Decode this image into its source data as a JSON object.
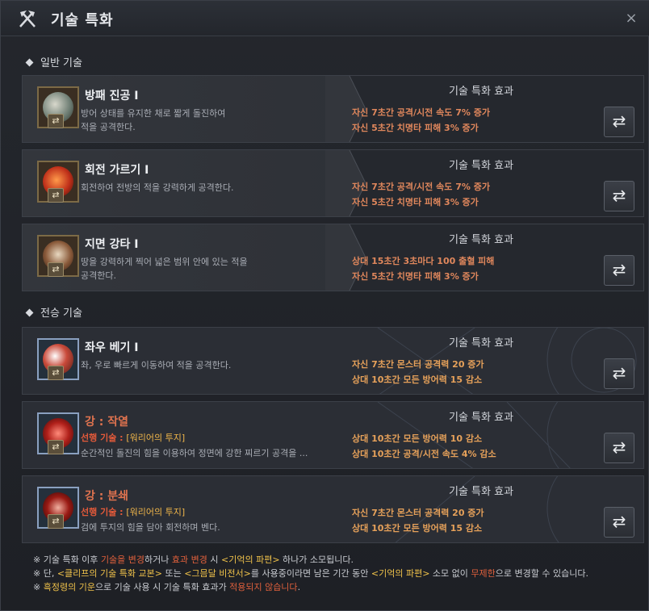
{
  "window": {
    "title": "기술 특화",
    "close_label": "×"
  },
  "sections": {
    "general": "일반 기술",
    "inherited": "전승 기술"
  },
  "effect_header": "기술 특화 효과",
  "swap_icon": "swap-arrows-icon",
  "swap_glyph": "⇄",
  "badge_glyph": "⇄",
  "general_skills": [
    {
      "name": "방패 진공 I",
      "desc1": "방어 상태를 유지한 채로 짧게 돌진하여",
      "desc2": "적을 공격한다.",
      "effects": [
        "자신 7초간 공격/시전 속도 7% 증가",
        "자신 5초간 치명타 피해 3% 증가"
      ]
    },
    {
      "name": "회전 가르기 I",
      "desc1": "회전하여 전방의 적을 강력하게 공격한다.",
      "desc2": "",
      "effects": [
        "자신 7초간 공격/시전 속도 7% 증가",
        "자신 5초간 치명타 피해 3% 증가"
      ]
    },
    {
      "name": "지면 강타 I",
      "desc1": "땅을 강력하게 찍어 넓은 범위 안에 있는 적을",
      "desc2": "공격한다.",
      "effects": [
        "상대 15초간 3초마다 100 출혈 피해",
        "자신 5초간 치명타 피해 3% 증가"
      ]
    }
  ],
  "inherited_skills": [
    {
      "name": "좌우 베기 I",
      "desc1": "좌, 우로 빠르게 이동하여 적을 공격한다.",
      "effects": [
        "자신 7초간 몬스터 공격력 20 증가",
        "상대 10초간 모든 방어력 15 감소"
      ]
    },
    {
      "name": "강 : 작열",
      "pre_label": "선행 기술 : ",
      "pre_value": "[워리어의 투지]",
      "desc2": "순간적인 돌진의 힘을 이용하여 정면에 강한 찌르기 공격을 ...",
      "effects": [
        "상대 10초간 모든 방어력 10 감소",
        "상대 10초간 공격/시전 속도 4% 감소"
      ]
    },
    {
      "name": "강 : 분쇄",
      "pre_label": "선행 기술 : ",
      "pre_value": "[워리어의 투지]",
      "desc2": "검에 투지의 힘을 담아 회전하며 벤다.",
      "effects": [
        "자신 7초간 몬스터 공격력 20 증가",
        "상대 10초간 모든 방어력 15 감소"
      ]
    }
  ],
  "footnotes": {
    "n1": {
      "a": "※ 기술 특화 이후 ",
      "b": "기술을 변경",
      "c": "하거나 ",
      "d": "효과 변경",
      "e": " 시 ",
      "f": "<기억의 파편>",
      "g": " 하나가 소모됩니다."
    },
    "n2": {
      "a": "※ 단, ",
      "b": "<클리프의 기술 특화 교본>",
      "c": " 또는 ",
      "d": "<그믐달 비전서>",
      "e": "를 사용중이라면 남은 기간 동안 ",
      "f": "<기억의 파편>",
      "g": " 소모 없이 ",
      "h": "무제한",
      "i": "으로 변경할 수 있습니다."
    },
    "n3": {
      "a": "※ ",
      "b": "흑정령의 기운",
      "c": "으로 기술 사용 시 기술 특화 효과가 ",
      "d": "적용되지 않습니다",
      "e": "."
    }
  },
  "colors": {
    "effect_general": "#e0875c",
    "effect_inherited": "#e6a15a",
    "highlight_red": "#e0603c",
    "highlight_yellow": "#f0c24a"
  }
}
